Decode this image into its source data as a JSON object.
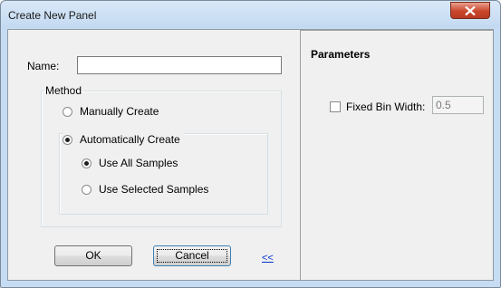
{
  "window": {
    "title": "Create New Panel"
  },
  "form": {
    "name_label": "Name:",
    "name_value": "",
    "method_legend": "Method",
    "manual_label": "Manually Create",
    "auto_label": "Automatically Create",
    "use_all_label": "Use All Samples",
    "use_selected_label": "Use Selected Samples",
    "selected_method": "Automatically Create",
    "selected_sample_option": "Use All Samples"
  },
  "buttons": {
    "ok_label": "OK",
    "cancel_label": "Cancel",
    "collapse_label": "<<"
  },
  "parameters": {
    "title": "Parameters",
    "fixed_bin_label": "Fixed Bin Width:",
    "fixed_bin_checked": false,
    "bin_width_value": "0.5"
  },
  "colors": {
    "title_bar": "#c9ddf3",
    "close_button": "#c9462c",
    "dialog_face": "#f0f0f0",
    "link": "#0033cc"
  }
}
